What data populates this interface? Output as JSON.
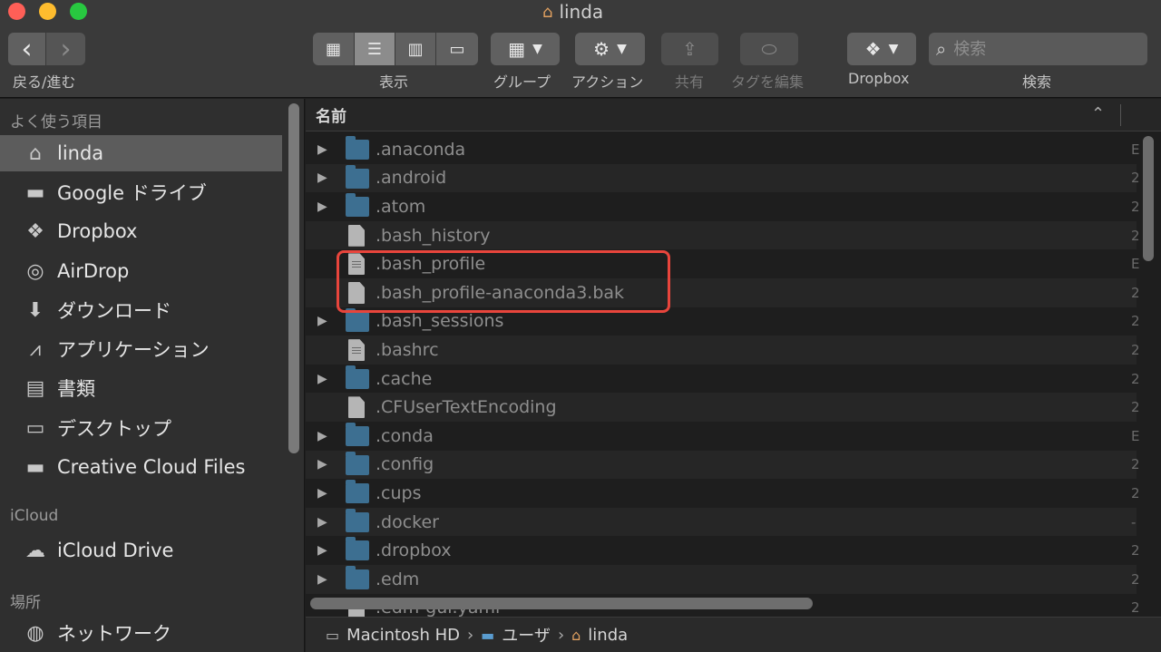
{
  "window": {
    "title": "linda"
  },
  "toolbar": {
    "back_forward_label": "戻る/進む",
    "view_label": "表示",
    "group_label": "グループ",
    "action_label": "アクション",
    "share_label": "共有",
    "tags_label": "タグを編集",
    "dropbox_label": "Dropbox",
    "search_label": "検索",
    "search_placeholder": "検索",
    "back_icon": "‹",
    "forward_icon": "›"
  },
  "sidebar": {
    "favorites_heading": "よく使う項目",
    "favorites": [
      {
        "label": "linda",
        "icon": "home-icon",
        "selected": true
      },
      {
        "label": "Google ドライブ",
        "icon": "folder-icon"
      },
      {
        "label": "Dropbox",
        "icon": "dropbox-icon"
      },
      {
        "label": "AirDrop",
        "icon": "airdrop-icon"
      },
      {
        "label": "ダウンロード",
        "icon": "download-icon"
      },
      {
        "label": "アプリケーション",
        "icon": "applications-icon"
      },
      {
        "label": "書類",
        "icon": "documents-icon"
      },
      {
        "label": "デスクトップ",
        "icon": "desktop-icon"
      },
      {
        "label": "Creative Cloud Files",
        "icon": "folder-icon"
      }
    ],
    "icloud_heading": "iCloud",
    "icloud": [
      {
        "label": "iCloud Drive",
        "icon": "cloud-icon"
      }
    ],
    "places_heading": "場所",
    "places": [
      {
        "label": "ネットワーク",
        "icon": "network-icon"
      }
    ]
  },
  "file_list": {
    "column_name": "名前",
    "rows": [
      {
        "name": ".anaconda",
        "type": "folder",
        "right": "E"
      },
      {
        "name": ".android",
        "type": "folder",
        "right": "2"
      },
      {
        "name": ".atom",
        "type": "folder",
        "right": "2"
      },
      {
        "name": ".bash_history",
        "type": "file",
        "right": "2"
      },
      {
        "name": ".bash_profile",
        "type": "textfile",
        "right": "E"
      },
      {
        "name": ".bash_profile-anaconda3.bak",
        "type": "file",
        "right": "2"
      },
      {
        "name": ".bash_sessions",
        "type": "folder",
        "right": "2"
      },
      {
        "name": ".bashrc",
        "type": "textfile",
        "right": "2"
      },
      {
        "name": ".cache",
        "type": "folder",
        "right": "2"
      },
      {
        "name": ".CFUserTextEncoding",
        "type": "file",
        "right": "2"
      },
      {
        "name": ".conda",
        "type": "folder",
        "right": "E"
      },
      {
        "name": ".config",
        "type": "folder",
        "right": "2"
      },
      {
        "name": ".cups",
        "type": "folder",
        "right": "2"
      },
      {
        "name": ".docker",
        "type": "folder",
        "right": "-"
      },
      {
        "name": ".dropbox",
        "type": "folder",
        "right": "2"
      },
      {
        "name": ".edm",
        "type": "folder",
        "right": "2"
      },
      {
        "name": ".edm-gui.yaml",
        "type": "file",
        "right": "2"
      }
    ]
  },
  "pathbar": {
    "items": [
      "Macintosh HD",
      "ユーザ",
      "linda"
    ],
    "separator": "›"
  },
  "colors": {
    "highlight": "#e8453c",
    "folder": "#3d6f91",
    "selection": "#5c5c5c"
  }
}
